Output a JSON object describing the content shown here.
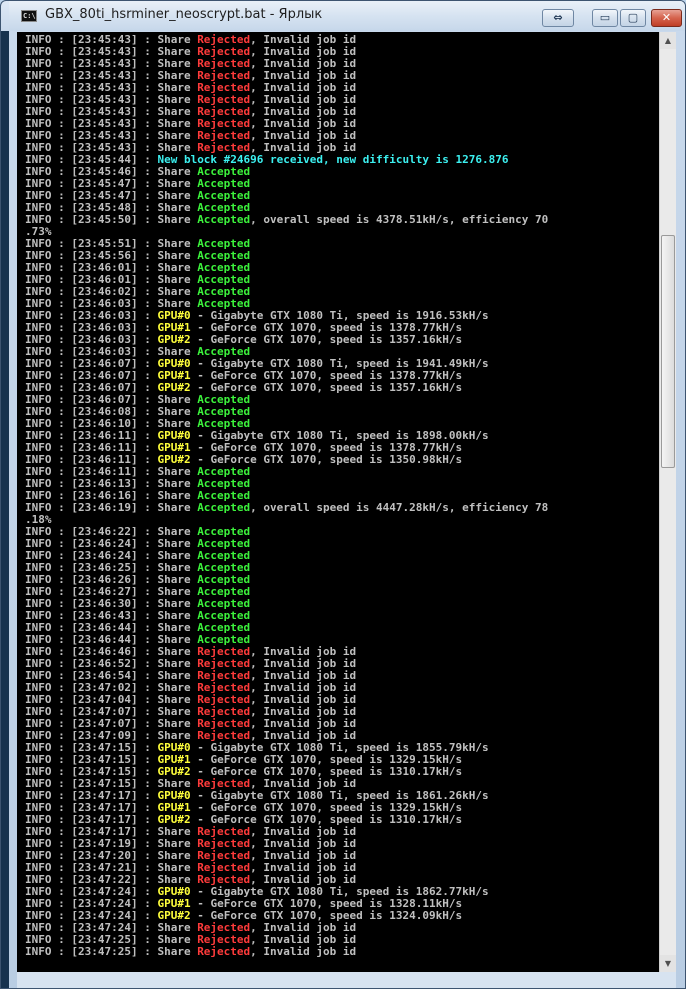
{
  "window": {
    "icon_text": "C:\\",
    "title": "GBX_80ti_hsrminer_neoscrypt.bat - Ярлык",
    "buttons": {
      "restore": "⇔",
      "minimize": "▭",
      "maximize": "▢",
      "close": "✕"
    }
  },
  "colors": {
    "background": "#000000",
    "text": "#c0c0c0",
    "rejected": "#ff3b3b",
    "accepted": "#3cf23c",
    "gpu": "#ffff3c",
    "block": "#3cf0f0"
  },
  "scrollbar": {
    "up_icon": "▲",
    "down_icon": "▼",
    "position_fraction": 0.25
  },
  "log_lines": [
    [
      [
        "INFO : [23:45:43] : Share ",
        ""
      ],
      [
        "Rejected",
        "red"
      ],
      [
        ", Invalid job id",
        ""
      ]
    ],
    [
      [
        "INFO : [23:45:43] : Share ",
        ""
      ],
      [
        "Rejected",
        "red"
      ],
      [
        ", Invalid job id",
        ""
      ]
    ],
    [
      [
        "INFO : [23:45:43] : Share ",
        ""
      ],
      [
        "Rejected",
        "red"
      ],
      [
        ", Invalid job id",
        ""
      ]
    ],
    [
      [
        "INFO : [23:45:43] : Share ",
        ""
      ],
      [
        "Rejected",
        "red"
      ],
      [
        ", Invalid job id",
        ""
      ]
    ],
    [
      [
        "INFO : [23:45:43] : Share ",
        ""
      ],
      [
        "Rejected",
        "red"
      ],
      [
        ", Invalid job id",
        ""
      ]
    ],
    [
      [
        "INFO : [23:45:43] : Share ",
        ""
      ],
      [
        "Rejected",
        "red"
      ],
      [
        ", Invalid job id",
        ""
      ]
    ],
    [
      [
        "INFO : [23:45:43] : Share ",
        ""
      ],
      [
        "Rejected",
        "red"
      ],
      [
        ", Invalid job id",
        ""
      ]
    ],
    [
      [
        "INFO : [23:45:43] : Share ",
        ""
      ],
      [
        "Rejected",
        "red"
      ],
      [
        ", Invalid job id",
        ""
      ]
    ],
    [
      [
        "INFO : [23:45:43] : Share ",
        ""
      ],
      [
        "Rejected",
        "red"
      ],
      [
        ", Invalid job id",
        ""
      ]
    ],
    [
      [
        "INFO : [23:45:43] : Share ",
        ""
      ],
      [
        "Rejected",
        "red"
      ],
      [
        ", Invalid job id",
        ""
      ]
    ],
    [
      [
        "INFO : [23:45:44] : ",
        ""
      ],
      [
        "New block #24696 received, new difficulty is 1276.876",
        "cyan"
      ]
    ],
    [
      [
        "INFO : [23:45:46] : Share ",
        ""
      ],
      [
        "Accepted",
        "green"
      ]
    ],
    [
      [
        "INFO : [23:45:47] : Share ",
        ""
      ],
      [
        "Accepted",
        "green"
      ]
    ],
    [
      [
        "INFO : [23:45:47] : Share ",
        ""
      ],
      [
        "Accepted",
        "green"
      ]
    ],
    [
      [
        "INFO : [23:45:48] : Share ",
        ""
      ],
      [
        "Accepted",
        "green"
      ]
    ],
    [
      [
        "INFO : [23:45:50] : Share ",
        ""
      ],
      [
        "Accepted",
        "green"
      ],
      [
        ", overall speed is 4378.51kH/s, efficiency 70",
        ""
      ]
    ],
    [
      [
        ".73%",
        ""
      ]
    ],
    [
      [
        "INFO : [23:45:51] : Share ",
        ""
      ],
      [
        "Accepted",
        "green"
      ]
    ],
    [
      [
        "INFO : [23:45:56] : Share ",
        ""
      ],
      [
        "Accepted",
        "green"
      ]
    ],
    [
      [
        "INFO : [23:46:01] : Share ",
        ""
      ],
      [
        "Accepted",
        "green"
      ]
    ],
    [
      [
        "INFO : [23:46:01] : Share ",
        ""
      ],
      [
        "Accepted",
        "green"
      ]
    ],
    [
      [
        "INFO : [23:46:02] : Share ",
        ""
      ],
      [
        "Accepted",
        "green"
      ]
    ],
    [
      [
        "INFO : [23:46:03] : Share ",
        ""
      ],
      [
        "Accepted",
        "green"
      ]
    ],
    [
      [
        "INFO : [23:46:03] : ",
        ""
      ],
      [
        "GPU#0",
        "yellow"
      ],
      [
        " - Gigabyte GTX 1080 Ti, speed is 1916.53kH/s",
        ""
      ]
    ],
    [
      [
        "INFO : [23:46:03] : ",
        ""
      ],
      [
        "GPU#1",
        "yellow"
      ],
      [
        " - GeForce GTX 1070, speed is 1378.77kH/s",
        ""
      ]
    ],
    [
      [
        "INFO : [23:46:03] : ",
        ""
      ],
      [
        "GPU#2",
        "yellow"
      ],
      [
        " - GeForce GTX 1070, speed is 1357.16kH/s",
        ""
      ]
    ],
    [
      [
        "INFO : [23:46:03] : Share ",
        ""
      ],
      [
        "Accepted",
        "green"
      ]
    ],
    [
      [
        "INFO : [23:46:07] : ",
        ""
      ],
      [
        "GPU#0",
        "yellow"
      ],
      [
        " - Gigabyte GTX 1080 Ti, speed is 1941.49kH/s",
        ""
      ]
    ],
    [
      [
        "INFO : [23:46:07] : ",
        ""
      ],
      [
        "GPU#1",
        "yellow"
      ],
      [
        " - GeForce GTX 1070, speed is 1378.77kH/s",
        ""
      ]
    ],
    [
      [
        "INFO : [23:46:07] : ",
        ""
      ],
      [
        "GPU#2",
        "yellow"
      ],
      [
        " - GeForce GTX 1070, speed is 1357.16kH/s",
        ""
      ]
    ],
    [
      [
        "INFO : [23:46:07] : Share ",
        ""
      ],
      [
        "Accepted",
        "green"
      ]
    ],
    [
      [
        "INFO : [23:46:08] : Share ",
        ""
      ],
      [
        "Accepted",
        "green"
      ]
    ],
    [
      [
        "INFO : [23:46:10] : Share ",
        ""
      ],
      [
        "Accepted",
        "green"
      ]
    ],
    [
      [
        "INFO : [23:46:11] : ",
        ""
      ],
      [
        "GPU#0",
        "yellow"
      ],
      [
        " - Gigabyte GTX 1080 Ti, speed is 1898.00kH/s",
        ""
      ]
    ],
    [
      [
        "INFO : [23:46:11] : ",
        ""
      ],
      [
        "GPU#1",
        "yellow"
      ],
      [
        " - GeForce GTX 1070, speed is 1378.77kH/s",
        ""
      ]
    ],
    [
      [
        "INFO : [23:46:11] : ",
        ""
      ],
      [
        "GPU#2",
        "yellow"
      ],
      [
        " - GeForce GTX 1070, speed is 1350.98kH/s",
        ""
      ]
    ],
    [
      [
        "INFO : [23:46:11] : Share ",
        ""
      ],
      [
        "Accepted",
        "green"
      ]
    ],
    [
      [
        "INFO : [23:46:13] : Share ",
        ""
      ],
      [
        "Accepted",
        "green"
      ]
    ],
    [
      [
        "INFO : [23:46:16] : Share ",
        ""
      ],
      [
        "Accepted",
        "green"
      ]
    ],
    [
      [
        "INFO : [23:46:19] : Share ",
        ""
      ],
      [
        "Accepted",
        "green"
      ],
      [
        ", overall speed is 4447.28kH/s, efficiency 78",
        ""
      ]
    ],
    [
      [
        ".18%",
        ""
      ]
    ],
    [
      [
        "INFO : [23:46:22] : Share ",
        ""
      ],
      [
        "Accepted",
        "green"
      ]
    ],
    [
      [
        "INFO : [23:46:24] : Share ",
        ""
      ],
      [
        "Accepted",
        "green"
      ]
    ],
    [
      [
        "INFO : [23:46:24] : Share ",
        ""
      ],
      [
        "Accepted",
        "green"
      ]
    ],
    [
      [
        "INFO : [23:46:25] : Share ",
        ""
      ],
      [
        "Accepted",
        "green"
      ]
    ],
    [
      [
        "INFO : [23:46:26] : Share ",
        ""
      ],
      [
        "Accepted",
        "green"
      ]
    ],
    [
      [
        "INFO : [23:46:27] : Share ",
        ""
      ],
      [
        "Accepted",
        "green"
      ]
    ],
    [
      [
        "INFO : [23:46:30] : Share ",
        ""
      ],
      [
        "Accepted",
        "green"
      ]
    ],
    [
      [
        "INFO : [23:46:43] : Share ",
        ""
      ],
      [
        "Accepted",
        "green"
      ]
    ],
    [
      [
        "INFO : [23:46:44] : Share ",
        ""
      ],
      [
        "Accepted",
        "green"
      ]
    ],
    [
      [
        "INFO : [23:46:44] : Share ",
        ""
      ],
      [
        "Accepted",
        "green"
      ]
    ],
    [
      [
        "INFO : [23:46:46] : Share ",
        ""
      ],
      [
        "Rejected",
        "red"
      ],
      [
        ", Invalid job id",
        ""
      ]
    ],
    [
      [
        "INFO : [23:46:52] : Share ",
        ""
      ],
      [
        "Rejected",
        "red"
      ],
      [
        ", Invalid job id",
        ""
      ]
    ],
    [
      [
        "INFO : [23:46:54] : Share ",
        ""
      ],
      [
        "Rejected",
        "red"
      ],
      [
        ", Invalid job id",
        ""
      ]
    ],
    [
      [
        "INFO : [23:47:02] : Share ",
        ""
      ],
      [
        "Rejected",
        "red"
      ],
      [
        ", Invalid job id",
        ""
      ]
    ],
    [
      [
        "INFO : [23:47:04] : Share ",
        ""
      ],
      [
        "Rejected",
        "red"
      ],
      [
        ", Invalid job id",
        ""
      ]
    ],
    [
      [
        "INFO : [23:47:07] : Share ",
        ""
      ],
      [
        "Rejected",
        "red"
      ],
      [
        ", Invalid job id",
        ""
      ]
    ],
    [
      [
        "INFO : [23:47:07] : Share ",
        ""
      ],
      [
        "Rejected",
        "red"
      ],
      [
        ", Invalid job id",
        ""
      ]
    ],
    [
      [
        "INFO : [23:47:09] : Share ",
        ""
      ],
      [
        "Rejected",
        "red"
      ],
      [
        ", Invalid job id",
        ""
      ]
    ],
    [
      [
        "INFO : [23:47:15] : ",
        ""
      ],
      [
        "GPU#0",
        "yellow"
      ],
      [
        " - Gigabyte GTX 1080 Ti, speed is 1855.79kH/s",
        ""
      ]
    ],
    [
      [
        "INFO : [23:47:15] : ",
        ""
      ],
      [
        "GPU#1",
        "yellow"
      ],
      [
        " - GeForce GTX 1070, speed is 1329.15kH/s",
        ""
      ]
    ],
    [
      [
        "INFO : [23:47:15] : ",
        ""
      ],
      [
        "GPU#2",
        "yellow"
      ],
      [
        " - GeForce GTX 1070, speed is 1310.17kH/s",
        ""
      ]
    ],
    [
      [
        "INFO : [23:47:15] : Share ",
        ""
      ],
      [
        "Rejected",
        "red"
      ],
      [
        ", Invalid job id",
        ""
      ]
    ],
    [
      [
        "INFO : [23:47:17] : ",
        ""
      ],
      [
        "GPU#0",
        "yellow"
      ],
      [
        " - Gigabyte GTX 1080 Ti, speed is 1861.26kH/s",
        ""
      ]
    ],
    [
      [
        "INFO : [23:47:17] : ",
        ""
      ],
      [
        "GPU#1",
        "yellow"
      ],
      [
        " - GeForce GTX 1070, speed is 1329.15kH/s",
        ""
      ]
    ],
    [
      [
        "INFO : [23:47:17] : ",
        ""
      ],
      [
        "GPU#2",
        "yellow"
      ],
      [
        " - GeForce GTX 1070, speed is 1310.17kH/s",
        ""
      ]
    ],
    [
      [
        "INFO : [23:47:17] : Share ",
        ""
      ],
      [
        "Rejected",
        "red"
      ],
      [
        ", Invalid job id",
        ""
      ]
    ],
    [
      [
        "INFO : [23:47:19] : Share ",
        ""
      ],
      [
        "Rejected",
        "red"
      ],
      [
        ", Invalid job id",
        ""
      ]
    ],
    [
      [
        "INFO : [23:47:20] : Share ",
        ""
      ],
      [
        "Rejected",
        "red"
      ],
      [
        ", Invalid job id",
        ""
      ]
    ],
    [
      [
        "INFO : [23:47:21] : Share ",
        ""
      ],
      [
        "Rejected",
        "red"
      ],
      [
        ", Invalid job id",
        ""
      ]
    ],
    [
      [
        "INFO : [23:47:22] : Share ",
        ""
      ],
      [
        "Rejected",
        "red"
      ],
      [
        ", Invalid job id",
        ""
      ]
    ],
    [
      [
        "INFO : [23:47:24] : ",
        ""
      ],
      [
        "GPU#0",
        "yellow"
      ],
      [
        " - Gigabyte GTX 1080 Ti, speed is 1862.77kH/s",
        ""
      ]
    ],
    [
      [
        "INFO : [23:47:24] : ",
        ""
      ],
      [
        "GPU#1",
        "yellow"
      ],
      [
        " - GeForce GTX 1070, speed is 1328.11kH/s",
        ""
      ]
    ],
    [
      [
        "INFO : [23:47:24] : ",
        ""
      ],
      [
        "GPU#2",
        "yellow"
      ],
      [
        " - GeForce GTX 1070, speed is 1324.09kH/s",
        ""
      ]
    ],
    [
      [
        "INFO : [23:47:24] : Share ",
        ""
      ],
      [
        "Rejected",
        "red"
      ],
      [
        ", Invalid job id",
        ""
      ]
    ],
    [
      [
        "INFO : [23:47:25] : Share ",
        ""
      ],
      [
        "Rejected",
        "red"
      ],
      [
        ", Invalid job id",
        ""
      ]
    ],
    [
      [
        "INFO : [23:47:25] : Share ",
        ""
      ],
      [
        "Rejected",
        "red"
      ],
      [
        ", Invalid job id",
        ""
      ]
    ]
  ]
}
